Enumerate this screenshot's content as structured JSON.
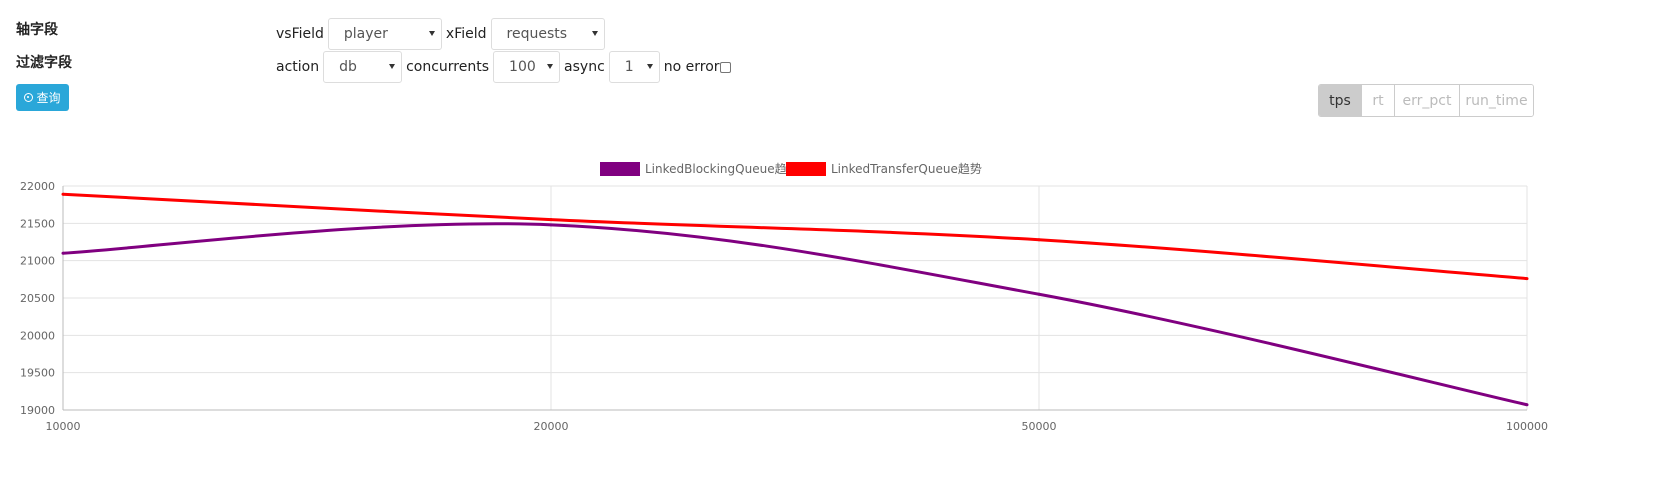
{
  "sidebar": {
    "axis_field_label": "轴字段",
    "filter_field_label": "过滤字段",
    "query_button": "查询"
  },
  "axis_row": {
    "vs_field_label": "vsField",
    "vs_field_value": "player",
    "x_field_label": "xField",
    "x_field_value": "requests"
  },
  "filter_row": {
    "action_label": "action",
    "action_value": "db",
    "concurrents_label": "concurrents",
    "concurrents_value": "100",
    "async_label": "async",
    "async_value": "1",
    "no_error_label": "no error",
    "no_error_checked": false
  },
  "metric_tabs": [
    {
      "label": "tps",
      "active": true
    },
    {
      "label": "rt",
      "active": false
    },
    {
      "label": "err_pct",
      "active": false
    },
    {
      "label": "run_time",
      "active": false
    }
  ],
  "chart_data": {
    "type": "line",
    "title": "",
    "xlabel": "",
    "ylabel": "",
    "x": [
      "10000",
      "20000",
      "50000",
      "100000"
    ],
    "ylim": [
      19000,
      22000
    ],
    "yticks": [
      19000,
      19500,
      20000,
      20500,
      21000,
      21500,
      22000
    ],
    "grid": true,
    "legend_position": "top-center",
    "series": [
      {
        "name": "LinkedBlockingQueue趋势",
        "color": "#800080",
        "values": [
          21100,
          21480,
          20550,
          19070
        ]
      },
      {
        "name": "LinkedTransferQueue趋势",
        "color": "#ff0000",
        "values": [
          21890,
          21550,
          21280,
          20760
        ]
      }
    ]
  }
}
